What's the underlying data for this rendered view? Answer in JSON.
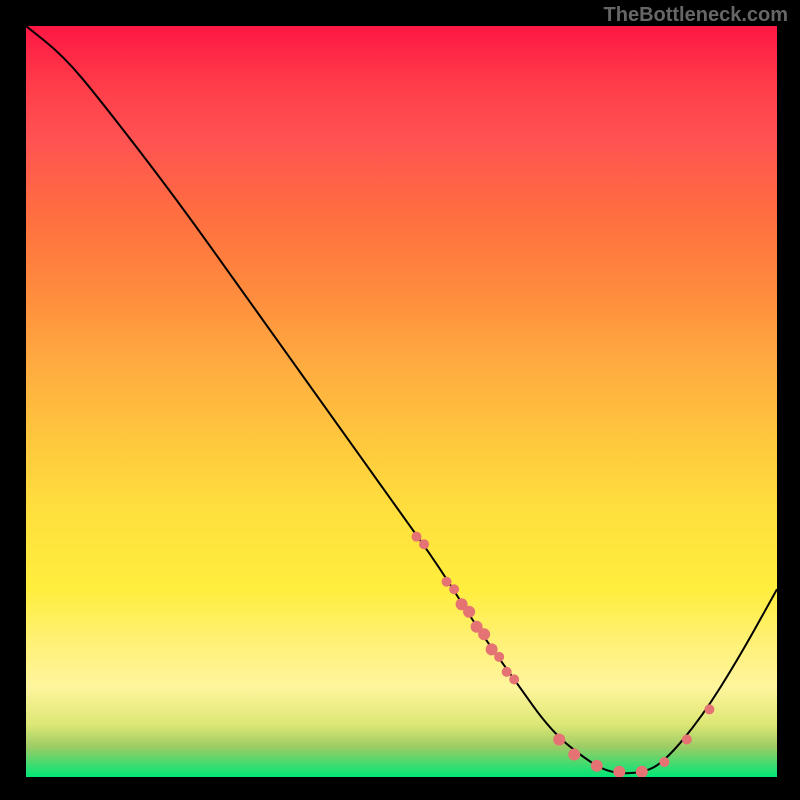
{
  "watermark": "TheBottleneck.com",
  "chart_data": {
    "type": "line",
    "title": "",
    "xlabel": "",
    "ylabel": "",
    "xlim": [
      0,
      100
    ],
    "ylim": [
      0,
      100
    ],
    "curve": [
      {
        "x": 0,
        "y": 100
      },
      {
        "x": 5,
        "y": 96
      },
      {
        "x": 10,
        "y": 90
      },
      {
        "x": 20,
        "y": 77
      },
      {
        "x": 30,
        "y": 63
      },
      {
        "x": 40,
        "y": 49
      },
      {
        "x": 50,
        "y": 35
      },
      {
        "x": 55,
        "y": 28
      },
      {
        "x": 60,
        "y": 20
      },
      {
        "x": 65,
        "y": 13
      },
      {
        "x": 70,
        "y": 6
      },
      {
        "x": 75,
        "y": 2
      },
      {
        "x": 78,
        "y": 0.5
      },
      {
        "x": 82,
        "y": 0.5
      },
      {
        "x": 85,
        "y": 2
      },
      {
        "x": 90,
        "y": 8
      },
      {
        "x": 95,
        "y": 16
      },
      {
        "x": 100,
        "y": 25
      }
    ],
    "markers": [
      {
        "x": 52,
        "y": 32,
        "r": 5
      },
      {
        "x": 53,
        "y": 31,
        "r": 5
      },
      {
        "x": 56,
        "y": 26,
        "r": 5
      },
      {
        "x": 57,
        "y": 25,
        "r": 5
      },
      {
        "x": 58,
        "y": 23,
        "r": 6
      },
      {
        "x": 59,
        "y": 22,
        "r": 6
      },
      {
        "x": 60,
        "y": 20,
        "r": 6
      },
      {
        "x": 61,
        "y": 19,
        "r": 6
      },
      {
        "x": 62,
        "y": 17,
        "r": 6
      },
      {
        "x": 63,
        "y": 16,
        "r": 5
      },
      {
        "x": 64,
        "y": 14,
        "r": 5
      },
      {
        "x": 65,
        "y": 13,
        "r": 5
      },
      {
        "x": 71,
        "y": 5,
        "r": 6
      },
      {
        "x": 73,
        "y": 3,
        "r": 6
      },
      {
        "x": 76,
        "y": 1.5,
        "r": 6
      },
      {
        "x": 79,
        "y": 0.7,
        "r": 6
      },
      {
        "x": 82,
        "y": 0.7,
        "r": 6
      },
      {
        "x": 85,
        "y": 2,
        "r": 5
      },
      {
        "x": 88,
        "y": 5,
        "r": 5
      },
      {
        "x": 91,
        "y": 9,
        "r": 5
      }
    ],
    "marker_color": "#e57373",
    "curve_color": "#000000"
  }
}
